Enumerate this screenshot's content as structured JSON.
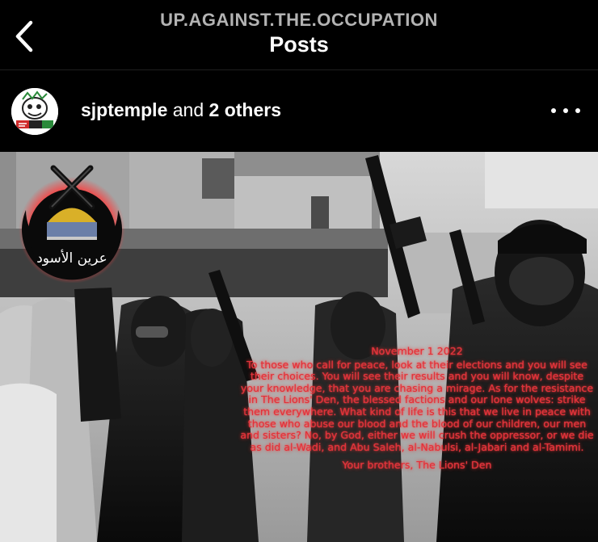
{
  "header": {
    "account_name": "UP.AGAINST.THE.OCCUPATION",
    "title": "Posts",
    "back_icon": "chevron-left-icon"
  },
  "post": {
    "username": "sjptemple",
    "coauthors_connector": "and",
    "coauthors_count_label": "2 others",
    "more_icon": "more-horizontal-icon",
    "image": {
      "date": "November 1 2022",
      "statement": "To those who call for peace, look at their elections and you will see their choices. You will see their results and you will know, despite your knowledge, that you are chasing a mirage. As for the resistance in The Lions' Den, the blessed factions and our lone wolves: strike them everywhere. What kind of life is this that we live in peace with those who abuse our blood and the blood of our children, our men and sisters? No, by God, either we will crush the oppressor, or we die as did al-Wadi, and Abu Saleh, al-Nabulsi, al-Jabari and al-Tamimi.",
      "signature": "Your brothers, The Lions' Den",
      "logo_script": "عرين الأسود",
      "text_color": "#e0313a"
    }
  }
}
